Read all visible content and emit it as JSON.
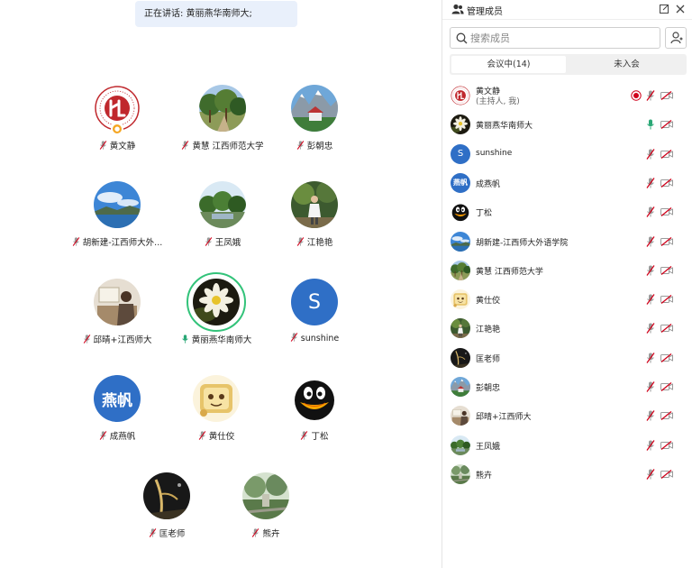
{
  "speaking": {
    "label": "正在讲话: 黄丽燕华南师大;"
  },
  "colors": {
    "accent": "#2f6fc6",
    "active_ring": "#33c37a",
    "muted": "#d0021b",
    "unmuted_mic": "#2aa876"
  },
  "gallery": [
    {
      "name": "黄文静",
      "avatar": "logo-red",
      "mic": "muted",
      "host": true
    },
    {
      "name": "黄慧 江西师范大学",
      "avatar": "photo-trees",
      "mic": "muted"
    },
    {
      "name": "彭朝忠",
      "avatar": "photo-mountain",
      "mic": "muted"
    },
    {
      "name": "胡新建-江西师大外...",
      "avatar": "photo-sky",
      "mic": "muted"
    },
    {
      "name": "王凤娥",
      "avatar": "photo-park",
      "mic": "muted"
    },
    {
      "name": "江艳艳",
      "avatar": "photo-girl",
      "mic": "muted"
    },
    {
      "name": "邱晴+江西师大",
      "avatar": "photo-room",
      "mic": "muted"
    },
    {
      "name": "黄丽燕华南师大",
      "avatar": "photo-flower",
      "mic": "on",
      "active": true
    },
    {
      "name": "sunshine",
      "avatar": "letter",
      "letter": "S",
      "mic": "muted"
    },
    {
      "name": "成燕帆",
      "avatar": "letter-cn",
      "letter": "燕帆",
      "mic": "muted"
    },
    {
      "name": "黄仕佼",
      "avatar": "cartoon",
      "mic": "muted"
    },
    {
      "name": "丁松",
      "avatar": "penguin",
      "mic": "muted"
    },
    {
      "name": "匡老师",
      "avatar": "photo-dark",
      "mic": "muted"
    },
    {
      "name": "熊卉",
      "avatar": "photo-garden",
      "mic": "muted"
    }
  ],
  "panel": {
    "title": "管理成员",
    "search_placeholder": "搜索成员",
    "tabs": {
      "in_meeting": "会议中(14)",
      "not_joined": "未入会"
    },
    "members": [
      {
        "name": "黄文静",
        "sub": "(主持人, 我)",
        "avatar": "logo-red",
        "mic": "muted",
        "recording": true
      },
      {
        "name": "黄丽燕华南师大",
        "avatar": "photo-flower",
        "mic": "on"
      },
      {
        "name": "sunshine",
        "avatar": "letter",
        "letter": "S",
        "mic": "muted"
      },
      {
        "name": "成燕帆",
        "avatar": "letter-cn",
        "letter": "燕帆",
        "mic": "muted"
      },
      {
        "name": "丁松",
        "avatar": "penguin",
        "mic": "muted"
      },
      {
        "name": "胡新建-江西师大外语学院",
        "avatar": "photo-sky",
        "mic": "muted"
      },
      {
        "name": "黄慧 江西师范大学",
        "avatar": "photo-trees",
        "mic": "muted"
      },
      {
        "name": "黄仕佼",
        "avatar": "cartoon",
        "mic": "muted"
      },
      {
        "name": "江艳艳",
        "avatar": "photo-girl",
        "mic": "muted"
      },
      {
        "name": "匡老师",
        "avatar": "photo-dark",
        "mic": "muted"
      },
      {
        "name": "彭朝忠",
        "avatar": "photo-mountain",
        "mic": "muted"
      },
      {
        "name": "邱晴+江西师大",
        "avatar": "photo-room",
        "mic": "muted"
      },
      {
        "name": "王凤娥",
        "avatar": "photo-park",
        "mic": "muted"
      },
      {
        "name": "熊卉",
        "avatar": "photo-garden",
        "mic": "muted"
      }
    ]
  }
}
